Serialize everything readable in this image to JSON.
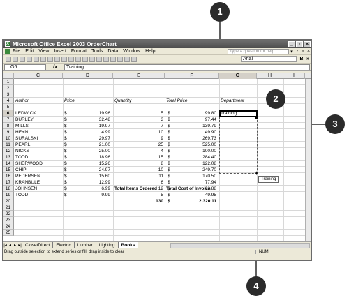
{
  "window": {
    "title": "Microsoft Office Excel 2003 OrderChart"
  },
  "menu": [
    "File",
    "Edit",
    "View",
    "Insert",
    "Format",
    "Tools",
    "Data",
    "Window",
    "Help"
  ],
  "help_placeholder": "Type a question for help",
  "font_name": "Arial",
  "formula_bar": {
    "name_box": "G6",
    "fx": "fx",
    "value": "Training"
  },
  "columns": [
    "C",
    "D",
    "E",
    "F",
    "G",
    "H",
    "I"
  ],
  "rows": [
    "1",
    "2",
    "3",
    "4",
    "5",
    "6",
    "7",
    "8",
    "9",
    "10",
    "11",
    "12",
    "13",
    "14",
    "15",
    "16",
    "17",
    "18",
    "19",
    "20",
    "21",
    "22",
    "23",
    "24",
    "25"
  ],
  "headers": {
    "author": "Author",
    "price": "Price",
    "quantity": "Quantity",
    "total_price": "Total Price",
    "department": "Department"
  },
  "data_rows": [
    [
      "LEDWICK",
      "$",
      "19.96",
      "5",
      "$",
      "99.80"
    ],
    [
      "BURLEY",
      "$",
      "32.48",
      "3",
      "$",
      "97.44"
    ],
    [
      "MILLS",
      "$",
      "19.97",
      "7",
      "$",
      "139.79"
    ],
    [
      "HEYN",
      "$",
      "4.99",
      "10",
      "$",
      "49.90"
    ],
    [
      "SURALSKI",
      "$",
      "29.97",
      "9",
      "$",
      "269.73"
    ],
    [
      "PEARL",
      "$",
      "21.00",
      "25",
      "$",
      "525.00"
    ],
    [
      "NICKS",
      "$",
      "25.00",
      "4",
      "$",
      "100.00"
    ],
    [
      "TODD",
      "$",
      "18.96",
      "15",
      "$",
      "284.40"
    ],
    [
      "SHERWOOD",
      "$",
      "15.26",
      "8",
      "$",
      "122.08"
    ],
    [
      "CHIP",
      "$",
      "24.97",
      "10",
      "$",
      "249.70"
    ],
    [
      "PEDERSEN",
      "$",
      "15.60",
      "11",
      "$",
      "170.50"
    ],
    [
      "KRANBULE",
      "$",
      "12.99",
      "6",
      "$",
      "77.94"
    ],
    [
      "JOHNSEN",
      "$",
      "6.99",
      "12",
      "$",
      "83.88"
    ],
    [
      "TODD",
      "$",
      "9.99",
      "5",
      "$",
      "49.95"
    ]
  ],
  "department_value": "Training",
  "totals": {
    "items_label": "Total Items Ordered",
    "invoice_label": "Total Cost of Invoice",
    "items_value": "130",
    "dollar": "$",
    "invoice_value": "2,320.11"
  },
  "fill_tooltip": "Training",
  "sheet_tabs": [
    "ClosetDirect",
    "Electric",
    "Lumber",
    "Lighting",
    "Books"
  ],
  "active_tab": "Books",
  "status": {
    "message": "Drag outside selection to extend series or fill; drag inside to clear",
    "mode": "NUM"
  },
  "callouts": [
    "1",
    "2",
    "3",
    "4"
  ]
}
